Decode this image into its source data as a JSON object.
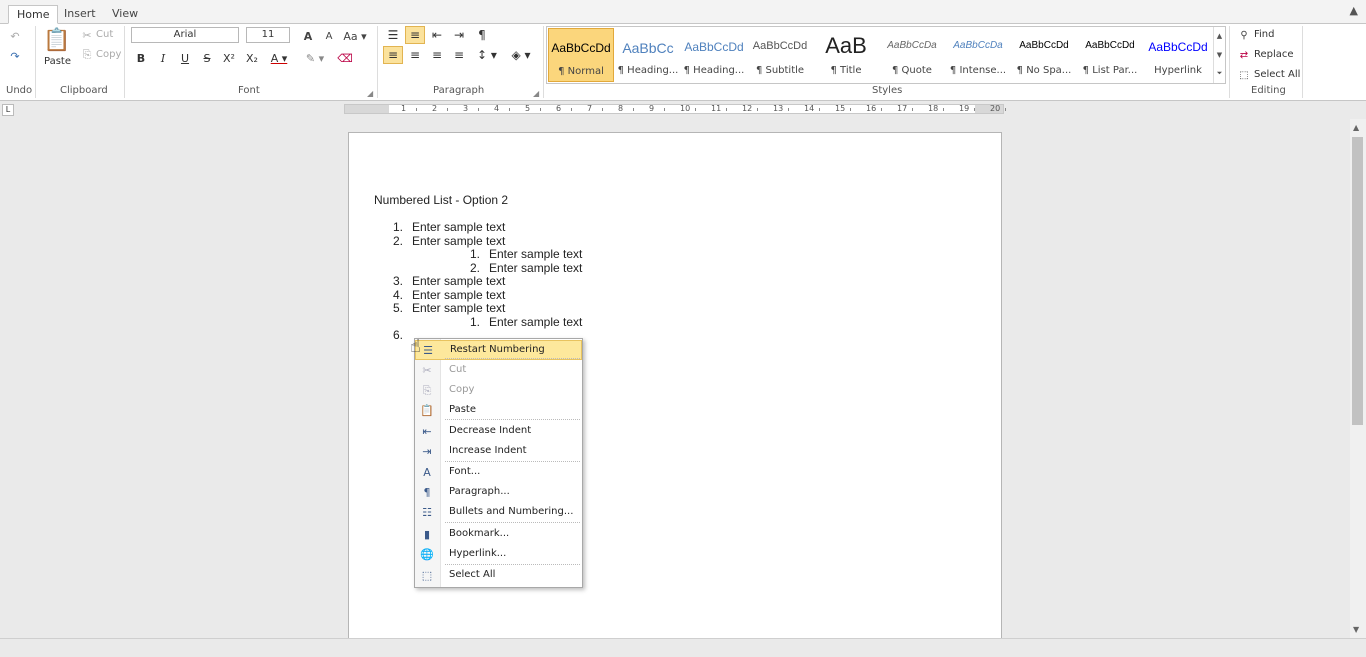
{
  "tabs": [
    "Home",
    "Insert",
    "View"
  ],
  "clipboard": {
    "paste": "Paste",
    "cut": "Cut",
    "copy": "Copy",
    "label": "Clipboard"
  },
  "undo": {
    "label": "Undo"
  },
  "font": {
    "name": "Arial",
    "size": "11",
    "label": "Font"
  },
  "paragraph": {
    "label": "Paragraph"
  },
  "styles": {
    "label": "Styles",
    "items": [
      {
        "preview": "AaBbCcDd",
        "name": "¶ Normal"
      },
      {
        "preview": "AaBbCc",
        "name": "¶ Heading..."
      },
      {
        "preview": "AaBbCcDd",
        "name": "¶ Heading..."
      },
      {
        "preview": "AaBbCcDd",
        "name": "¶ Subtitle"
      },
      {
        "preview": "AaB",
        "name": "¶ Title"
      },
      {
        "preview": "AaBbCcDa",
        "name": "¶ Quote"
      },
      {
        "preview": "AaBbCcDa",
        "name": "¶ Intense..."
      },
      {
        "preview": "AaBbCcDd",
        "name": "¶ No Spa..."
      },
      {
        "preview": "AaBbCcDd",
        "name": "¶ List Par..."
      },
      {
        "preview": "AaBbCcDd",
        "name": "Hyperlink"
      }
    ]
  },
  "editing": {
    "label": "Editing",
    "find": "Find",
    "replace": "Replace",
    "select_all": "Select All"
  },
  "ruler": {
    "numbers": [
      "1",
      "2",
      "3",
      "4",
      "5",
      "6",
      "7",
      "8",
      "9",
      "10",
      "11",
      "12",
      "13",
      "14",
      "15",
      "16",
      "17",
      "18",
      "19",
      "20"
    ]
  },
  "document": {
    "title": "Numbered List - Option 2",
    "list": [
      {
        "num": "1.",
        "text": "Enter sample text",
        "level": 1
      },
      {
        "num": "2.",
        "text": "Enter sample text",
        "level": 1
      },
      {
        "num": "1.",
        "text": "Enter sample text",
        "level": 2
      },
      {
        "num": "2.",
        "text": "Enter sample text",
        "level": 2
      },
      {
        "num": "3.",
        "text": "Enter sample text",
        "level": 1
      },
      {
        "num": "4.",
        "text": "Enter sample text",
        "level": 1
      },
      {
        "num": "5.",
        "text": "Enter sample text",
        "level": 1
      },
      {
        "num": "1.",
        "text": "Enter sample text",
        "level": 2
      },
      {
        "num": "6.",
        "text": "",
        "level": 1
      }
    ]
  },
  "context_menu": {
    "items": [
      {
        "label": "Restart Numbering",
        "icon": "restart-numbering-icon"
      },
      {
        "label": "Cut",
        "icon": "cut-icon"
      },
      {
        "label": "Copy",
        "icon": "copy-icon"
      },
      {
        "label": "Paste",
        "icon": "paste-icon"
      },
      {
        "label": "Decrease Indent",
        "icon": "decrease-indent-icon"
      },
      {
        "label": "Increase Indent",
        "icon": "increase-indent-icon"
      },
      {
        "label": "Font...",
        "icon": "font-icon"
      },
      {
        "label": "Paragraph...",
        "icon": "paragraph-icon"
      },
      {
        "label": "Bullets and Numbering...",
        "icon": "bullets-numbering-icon"
      },
      {
        "label": "Bookmark...",
        "icon": "bookmark-icon"
      },
      {
        "label": "Hyperlink...",
        "icon": "hyperlink-icon"
      },
      {
        "label": "Select All",
        "icon": "select-all-icon"
      }
    ]
  },
  "colors": {
    "accent_highlight": "#fbd67c",
    "menu_highlight": "#fde89c",
    "hyperlink": "#0000ff"
  }
}
